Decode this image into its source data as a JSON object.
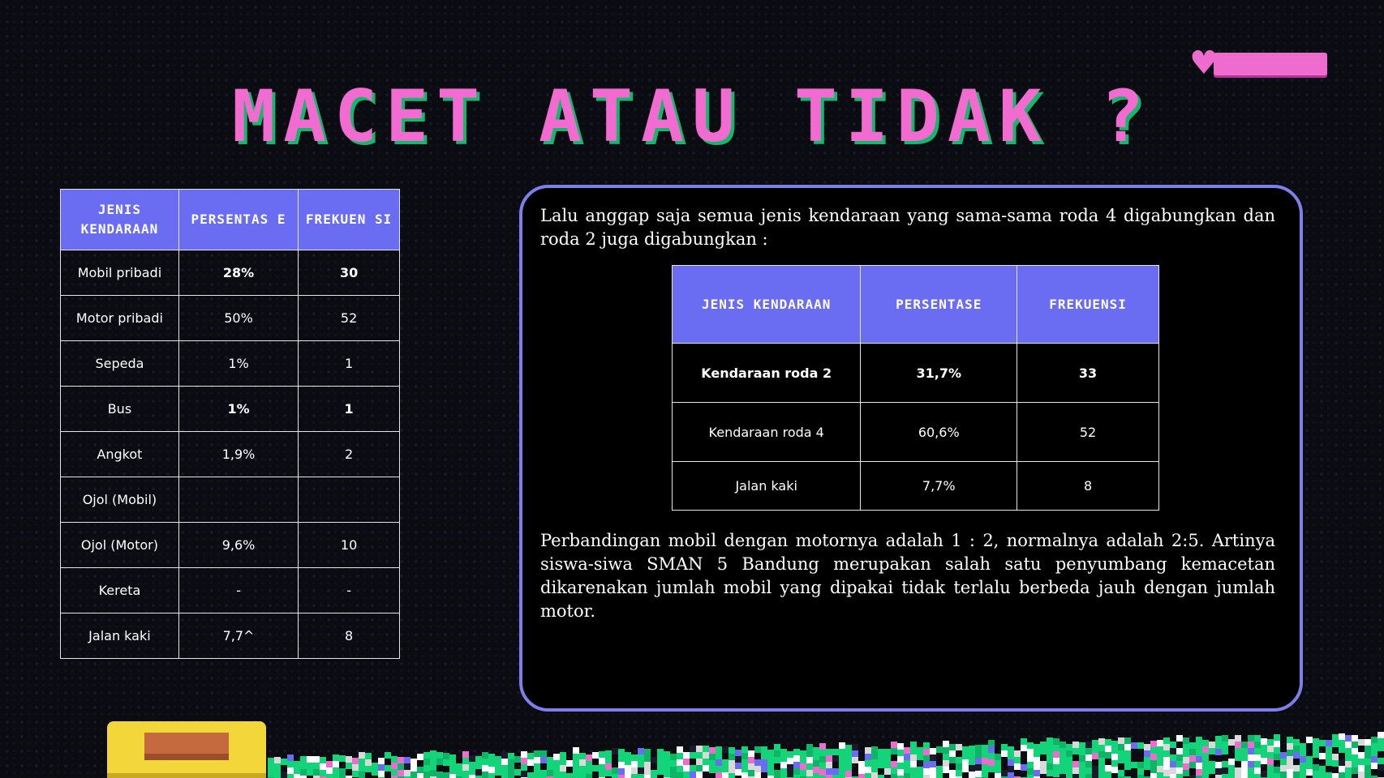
{
  "title": "MACET ATAU TIDAK ?",
  "colors": {
    "accent_pink": "#f26bd0",
    "accent_green": "#14b86a",
    "header_blue": "#6a6df2",
    "panel_border": "#7d80ea"
  },
  "decor": {
    "top_right": "heart-health-bar-icon",
    "bottom_left": "treasure-chest-icon",
    "bottom": "pixel-grass-icon"
  },
  "left_table": {
    "headers": [
      "JENIS KENDARAAN",
      "PERSENTAS E",
      "FREKUEN SI"
    ],
    "rows": [
      {
        "name": "Mobil pribadi",
        "pct": "28%",
        "freq": "30"
      },
      {
        "name": "Motor pribadi",
        "pct": "50%",
        "freq": "52"
      },
      {
        "name": "Sepeda",
        "pct": "1%",
        "freq": "1"
      },
      {
        "name": "Bus",
        "pct": "1%",
        "freq": "1"
      },
      {
        "name": "Angkot",
        "pct": "1,9%",
        "freq": "2"
      },
      {
        "name": "Ojol (Mobil)",
        "pct": "",
        "freq": ""
      },
      {
        "name": "Ojol (Motor)",
        "pct": "9,6%",
        "freq": "10"
      },
      {
        "name": "Kereta",
        "pct": "-",
        "freq": "-"
      },
      {
        "name": "Jalan kaki",
        "pct": "7,7^",
        "freq": "8"
      }
    ]
  },
  "panel": {
    "intro": "Lalu anggap saja semua jenis kendaraan yang sama-sama roda 4 digabungkan dan roda 2 juga digabungkan :",
    "table": {
      "headers": [
        "JENIS KENDARAAN",
        "PERSENTASE",
        "FREKUENSI"
      ],
      "rows": [
        {
          "name": "Kendaraan roda 2",
          "pct": "31,7%",
          "freq": "33"
        },
        {
          "name": "Kendaraan roda 4",
          "pct": "60,6%",
          "freq": "52"
        },
        {
          "name": "Jalan kaki",
          "pct": "7,7%",
          "freq": "8"
        }
      ]
    },
    "conclusion": "Perbandingan mobil dengan motornya adalah 1 : 2, normalnya adalah 2:5. Artinya siswa-siwa SMAN 5 Bandung merupakan salah satu penyumbang kemacetan dikarenakan jumlah mobil yang dipakai tidak terlalu berbeda jauh dengan jumlah motor."
  }
}
